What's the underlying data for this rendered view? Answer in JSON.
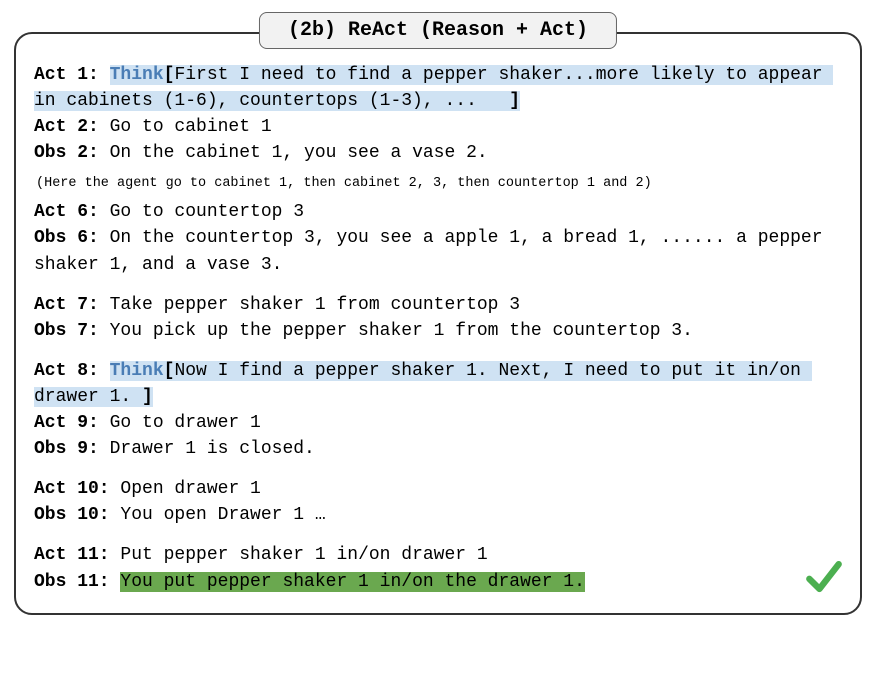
{
  "title": "(2b) ReAct (Reason + Act)",
  "think_keyword": "Think",
  "act1_label": "Act 1: ",
  "act1_bracket_open": "[",
  "act1_think_text": "First I need to find a pepper shaker...more likely to appear in cabinets (1-6), countertops (1-3), ...   ",
  "act1_bracket_close": "]",
  "act2_label": "Act 2:",
  "act2_text": " Go to cabinet 1",
  "obs2_label": "Obs 2:",
  "obs2_text": " On the cabinet 1, you see a vase 2.",
  "note": "(Here the agent go to cabinet 1, then cabinet 2, 3, then countertop 1 and 2)",
  "act6_label": "Act 6:",
  "act6_text": " Go to countertop 3",
  "obs6_label": "Obs 6:",
  "obs6_text": " On the countertop 3, you see a apple 1, a bread 1, ...... a pepper shaker 1, and a vase 3.",
  "act7_label": "Act 7:",
  "act7_text": " Take pepper shaker 1 from countertop 3",
  "obs7_label": "Obs 7:",
  "obs7_text": " You pick up the pepper shaker 1 from the countertop 3.",
  "act8_label": "Act 8: ",
  "act8_bracket_open": "[",
  "act8_think_text": "Now I find a pepper shaker 1. Next, I need to put it in/on drawer 1. ",
  "act8_bracket_close": "]",
  "act9_label": "Act 9:",
  "act9_text": " Go to drawer 1",
  "obs9_label": "Obs 9:",
  "obs9_text": " Drawer 1 is closed.",
  "act10_label": "Act 10:",
  "act10_text": " Open drawer 1",
  "obs10_label": "Obs 10:",
  "obs10_text": " You open Drawer 1 …",
  "act11_label": "Act 11:",
  "act11_text": " Put pepper shaker 1 in/on drawer 1",
  "obs11_label": "Obs 11: ",
  "obs11_text": "You put pepper shaker 1 in/on the drawer 1."
}
